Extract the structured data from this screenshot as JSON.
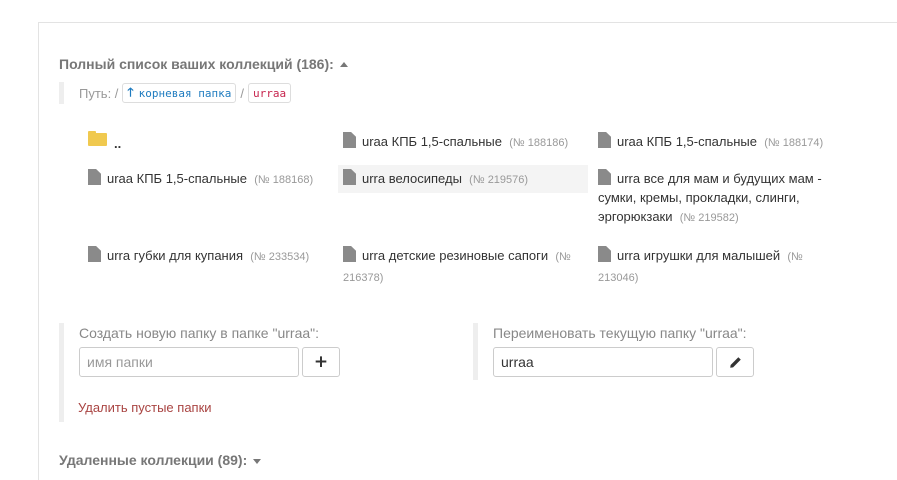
{
  "collections": {
    "title": "Полный список ваших коллекций (186):",
    "path_label": "Путь: /",
    "root_label": "корневая папка",
    "separator": "/",
    "current_folder": "urraa",
    "items": [
      {
        "name": "..",
        "num": "",
        "type": "folder"
      },
      {
        "name": "uraa КПБ 1,5-спальные",
        "num": "(№ 188186)",
        "type": "file"
      },
      {
        "name": "uraa КПБ 1,5-спальные",
        "num": "(№ 188174)",
        "type": "file"
      },
      {
        "name": "uraa КПБ 1,5-спальные",
        "num": "(№ 188168)",
        "type": "file"
      },
      {
        "name": "urra велосипеды",
        "num": "(№ 219576)",
        "type": "file"
      },
      {
        "name": "urra все для мам и будущих мам - сумки, кремы, прокладки, слинги, эргорюкзаки",
        "num": "(№ 219582)",
        "type": "file"
      },
      {
        "name": "urra губки для купания",
        "num": "(№ 233534)",
        "type": "file"
      },
      {
        "name": "urra детские резиновые сапоги",
        "num": "(№ 216378)",
        "type": "file"
      },
      {
        "name": "urra игрушки для малышей",
        "num": "(№ 213046)",
        "type": "file"
      }
    ]
  },
  "create_folder": {
    "label": "Создать новую папку в папке \"urraa\":",
    "placeholder": "имя папки",
    "value": ""
  },
  "rename_folder": {
    "label": "Переименовать текущую папку \"urraa\":",
    "value": "urraa"
  },
  "delete_empty_label": "Удалить пустые папки",
  "deleted": {
    "title": "Удаленные коллекции (89):"
  },
  "colors": {
    "link": "#1e7bbf",
    "danger": "#a94442",
    "folder": "#f0c94f",
    "code": "#c7254e"
  }
}
